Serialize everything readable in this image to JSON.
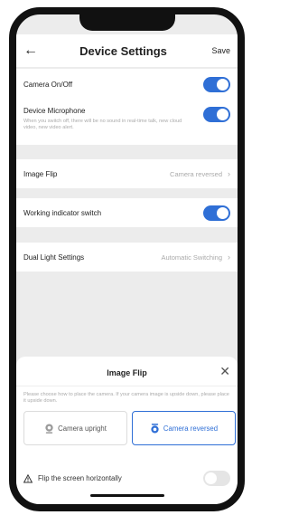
{
  "header": {
    "title": "Device Settings",
    "save_label": "Save"
  },
  "settings": {
    "camera": {
      "label": "Camera On/Off",
      "enabled": true
    },
    "microphone": {
      "label": "Device Microphone",
      "enabled": true,
      "description": "When you switch off, there will be no sound in real-time talk, new cloud video, new video alert."
    },
    "image_flip": {
      "label": "Image Flip",
      "value": "Camera reversed"
    },
    "indicator": {
      "label": "Working indicator switch",
      "enabled": true
    },
    "dual_light": {
      "label": "Dual Light Settings",
      "value": "Automatic Switching"
    }
  },
  "sheet": {
    "title": "Image Flip",
    "description": "Please choose how to place the camera. If your camera image is upside down, please place it upside down.",
    "options": [
      {
        "label": "Camera upright",
        "selected": false
      },
      {
        "label": "Camera reversed",
        "selected": true
      }
    ],
    "flip_horizontal": {
      "label": "Flip the screen horizontally",
      "enabled": false
    }
  },
  "colors": {
    "accent": "#2f6fd6",
    "toggle_off": "#e5e5e5",
    "muted_text": "#aaaaaa"
  }
}
